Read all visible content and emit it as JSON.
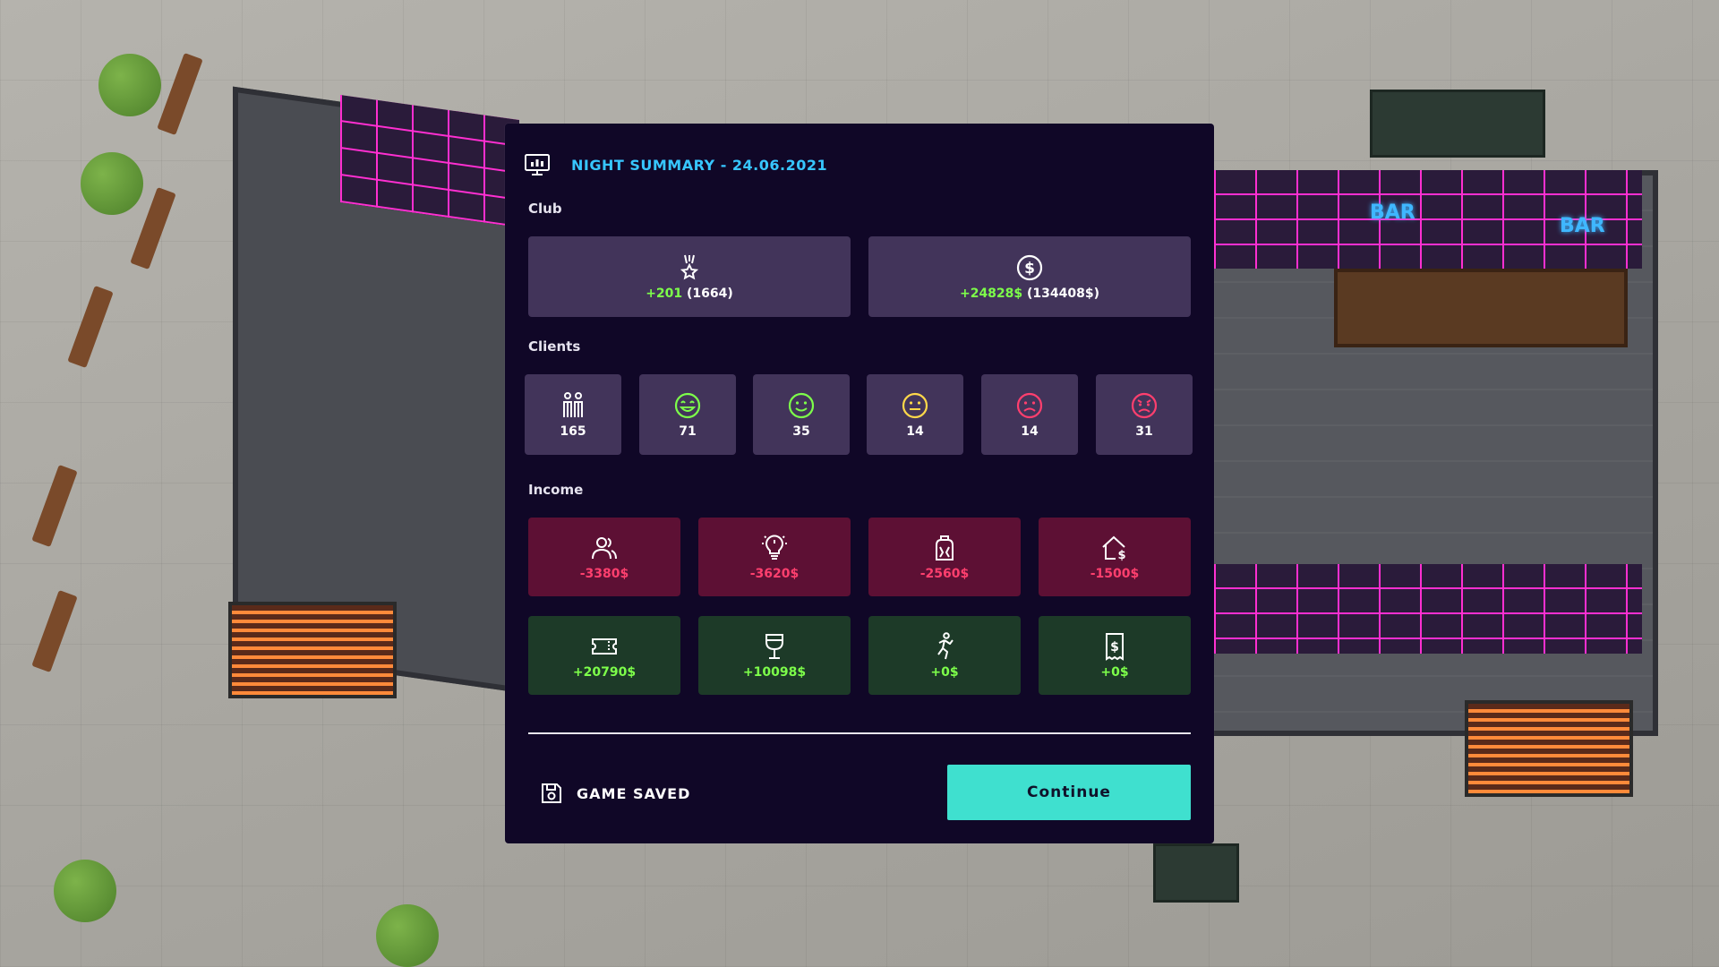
{
  "colors": {
    "header_title": "#37c6ff",
    "panel_bg": "#100727",
    "card_neutral": "#42345a",
    "card_expense": "#5d1034",
    "card_gain": "#1d3a28",
    "text_green": "#7dff4a",
    "text_red": "#ff3f6e",
    "text_yellow": "#ffd84a",
    "button_bg": "#3fe0cf"
  },
  "header": {
    "icon": "monitor-icon",
    "title": "NIGHT SUMMARY - 24.06.2021"
  },
  "club": {
    "label": "Club",
    "reputation": {
      "icon": "medal-icon",
      "delta": "+201",
      "total": "(1664)"
    },
    "money": {
      "icon": "dollar-coin-icon",
      "delta": "+24828$",
      "total": "(134408$)"
    }
  },
  "clients": {
    "label": "Clients",
    "items": [
      {
        "icon": "people-icon",
        "value": "165"
      },
      {
        "icon": "very-happy-face-icon",
        "value": "71"
      },
      {
        "icon": "happy-face-icon",
        "value": "35"
      },
      {
        "icon": "neutral-face-icon",
        "value": "14"
      },
      {
        "icon": "sad-face-icon",
        "value": "14"
      },
      {
        "icon": "angry-face-icon",
        "value": "31"
      }
    ]
  },
  "income": {
    "label": "Income",
    "expenses": [
      {
        "icon": "staff-icon",
        "value": "-3380$"
      },
      {
        "icon": "lightbulb-icon",
        "value": "-3620$"
      },
      {
        "icon": "cleaning-icon",
        "value": "-2560$"
      },
      {
        "icon": "house-dollar-icon",
        "value": "-1500$"
      }
    ],
    "gains": [
      {
        "icon": "ticket-icon",
        "value": "+20790$"
      },
      {
        "icon": "drink-glass-icon",
        "value": "+10098$"
      },
      {
        "icon": "dancer-icon",
        "value": "+0$"
      },
      {
        "icon": "receipt-dollar-icon",
        "value": "+0$"
      }
    ]
  },
  "footer": {
    "saved_icon": "save-disk-icon",
    "saved_text": "GAME SAVED",
    "continue_label": "Continue"
  }
}
